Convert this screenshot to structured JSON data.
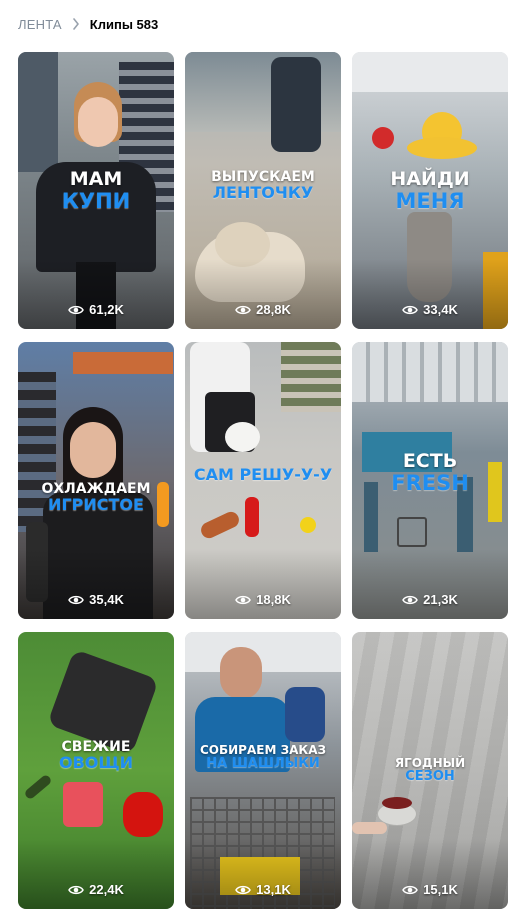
{
  "breadcrumb": {
    "parent": "ЛЕНТА",
    "current": "Клипы 583"
  },
  "clips": [
    {
      "line1": "МАМ",
      "line2": "КУПИ",
      "views": "61,2K",
      "style": "big"
    },
    {
      "line1": "ВЫПУСКАЕМ",
      "line2": "ЛЕНТОЧКУ",
      "views": "28,8K",
      "style": "small"
    },
    {
      "line1": "НАЙДИ",
      "line2": "МЕНЯ",
      "views": "33,4K",
      "style": "big"
    },
    {
      "line1": "ОХЛАЖДАЕМ",
      "line2": "ИГРИСТОЕ",
      "views": "35,4K",
      "style": "small"
    },
    {
      "line1": "",
      "line2": "САМ РЕШУ-У-У",
      "views": "18,8K",
      "style": "small"
    },
    {
      "line1": "ЕСТЬ",
      "line2": "FRESH",
      "views": "21,3K",
      "style": "big"
    },
    {
      "line1": "СВЕЖИЕ",
      "line2": "ОВОЩИ",
      "views": "22,4K",
      "style": "small"
    },
    {
      "line1": "СОБИРАЕМ ЗАКАЗ",
      "line2": "НА ШАШЛЫКИ",
      "views": "13,1K",
      "style": "tiny"
    },
    {
      "line1": "ЯГОДНЫЙ",
      "line2": "СЕЗОН",
      "views": "15,1K",
      "style": "tiny"
    }
  ],
  "icons": {
    "chevron": "chevron-right-icon",
    "eye": "eye-icon"
  },
  "colors": {
    "accent_blue": "#1f8ef1",
    "breadcrumb_gray": "#818c99"
  }
}
